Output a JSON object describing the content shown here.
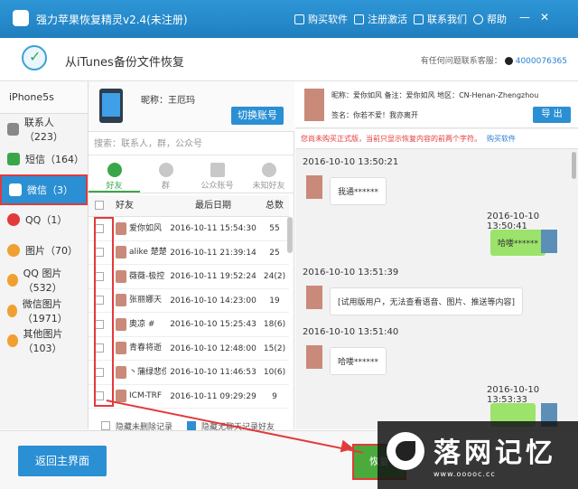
{
  "window": {
    "title": "强力苹果恢复精灵v2.4(未注册)",
    "menu": {
      "buy": "购买软件",
      "register": "注册激活",
      "contact": "联系我们",
      "help": "帮助"
    }
  },
  "header": {
    "page_title": "从iTunes备份文件恢复",
    "contact_label": "有任何问题联系客服：",
    "qq": "4000076365"
  },
  "sidebar": {
    "device": "iPhone5s",
    "items": [
      {
        "label": "联系人（223）",
        "color": "#888888"
      },
      {
        "label": "短信（164）",
        "color": "#3aa64a"
      },
      {
        "label": "微信（3）",
        "color": "#3aa64a"
      },
      {
        "label": "QQ（1）",
        "color": "#e23a3a"
      },
      {
        "label": "图片（70）",
        "color": "#f0a030"
      },
      {
        "label": "QQ 图片（532）",
        "color": "#f0a030"
      },
      {
        "label": "微信图片（1971）",
        "color": "#f0a030"
      },
      {
        "label": "其他图片（103）",
        "color": "#f0a030"
      }
    ]
  },
  "account": {
    "nickname": "昵称：王厄玛",
    "switch_label": "切换账号"
  },
  "search": {
    "placeholder": "搜索：联系人，群，公众号"
  },
  "tabs": [
    "好友",
    "群",
    "公众账号",
    "未知好友"
  ],
  "table": {
    "headers": [
      "好友",
      "最后日期",
      "总数"
    ],
    "rows": [
      {
        "name": "爱你如风",
        "date": "2016-10-11 15:54:30",
        "total": "55"
      },
      {
        "name": "alike 楚楚",
        "date": "2016-10-11 21:39:14",
        "total": "25"
      },
      {
        "name": "薇薇-极控",
        "date": "2016-10-11 19:52:24",
        "total": "24(2)"
      },
      {
        "name": "张丽娜天",
        "date": "2016-10-10 14:23:00",
        "total": "19"
      },
      {
        "name": "奥凉 #",
        "date": "2016-10-10 15:25:43",
        "total": "18(6)"
      },
      {
        "name": "青春将逝",
        "date": "2016-10-10 12:48:00",
        "total": "15(2)"
      },
      {
        "name": "丶蒲绿悲伤",
        "date": "2016-10-10 11:46:53",
        "total": "10(6)"
      },
      {
        "name": "ICM-TRF",
        "date": "2016-10-11 09:29:29",
        "total": "9"
      }
    ]
  },
  "options": {
    "hide_deleted": "隐藏未删除记录",
    "hide_empty": "隐藏无聊天记录好友"
  },
  "contact_info": {
    "line1": "昵称：爱你如风    备注：爱你如风    地区：CN-Henan-Zhengzhou",
    "line2": "签名：你若不爱！我亦离开",
    "export_label": "导 出"
  },
  "notice": {
    "text": "您尚未购买正式版，当前只显示恢复内容的前两个字符。",
    "buy_link": "购买软件"
  },
  "messages": [
    {
      "time": "2016-10-10 13:50:21",
      "dir": "in",
      "text": "我通******"
    },
    {
      "time": "2016-10-10 13:50:41",
      "dir": "out",
      "text": "哈喽******"
    },
    {
      "time": "2016-10-10 13:51:39",
      "dir": "in",
      "text": "[试用版用户，无法查看语音、图片、推送等内容]"
    },
    {
      "time": "2016-10-10 13:51:40",
      "dir": "in",
      "text": "哈喽******"
    },
    {
      "time": "2016-10-10 13:53:33",
      "dir": "out",
      "text": ""
    }
  ],
  "footer": {
    "back_label": "返回主界面",
    "recover_label": "恢复"
  },
  "watermark": {
    "text": "落网记忆",
    "url": "www.ooooc.cc"
  },
  "colors": {
    "accent": "#2b8fd4",
    "green": "#3aa64a",
    "alert": "#e23a3a"
  }
}
